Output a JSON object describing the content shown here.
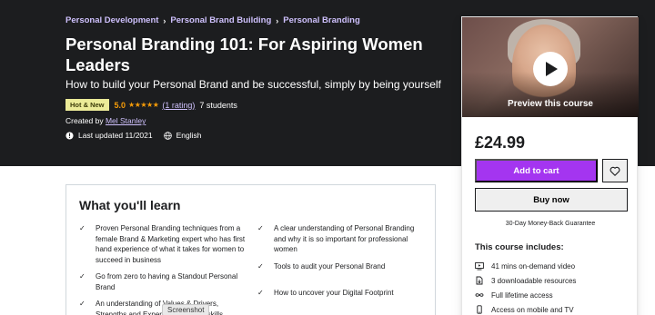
{
  "breadcrumb": [
    "Personal Development",
    "Personal Brand Building",
    "Personal Branding"
  ],
  "course": {
    "title": "Personal Branding 101: For Aspiring Women Leaders",
    "subtitle": "How to build your Personal Brand and be successful, simply by being yourself",
    "badge": "Hot & New",
    "rating": "5.0",
    "stars": "★★★★★",
    "rating_count": "(1 rating)",
    "students": "7 students",
    "created_by_label": "Created by",
    "instructor": "Mel Stanley",
    "last_updated": "Last updated 11/2021",
    "language": "English"
  },
  "sidebar": {
    "preview_label": "Preview this course",
    "price": "£24.99",
    "add_to_cart": "Add to cart",
    "buy_now": "Buy now",
    "guarantee": "30-Day Money-Back Guarantee",
    "includes_title": "This course includes:",
    "includes": [
      {
        "icon": "video-icon",
        "label": "41 mins on-demand video"
      },
      {
        "icon": "download-icon",
        "label": "3 downloadable resources"
      },
      {
        "icon": "infinity-icon",
        "label": "Full lifetime access"
      },
      {
        "icon": "mobile-tv-icon",
        "label": "Access on mobile and TV"
      }
    ]
  },
  "learn": {
    "title": "What you'll learn",
    "left": [
      "Proven Personal Branding techniques from a female Brand & Marketing expert who has first hand experience of what it takes for women to succeed in business",
      "Go from zero to having a Standout Personal Brand",
      "An understanding of Values & Drivers, Strengths and Experience ...these skills"
    ],
    "right": [
      "A clear understanding of Personal Branding and why it is so important for professional women",
      "Tools to audit your Personal Brand",
      "How to uncover your Digital Footprint"
    ]
  },
  "tooltip": "Screenshot",
  "colors": {
    "hero_bg": "#1c1d1f",
    "accent_purple": "#a435f0",
    "link_lilac": "#cec0fc",
    "star_orange": "#f69c08",
    "badge_yellow": "#eceb98"
  }
}
